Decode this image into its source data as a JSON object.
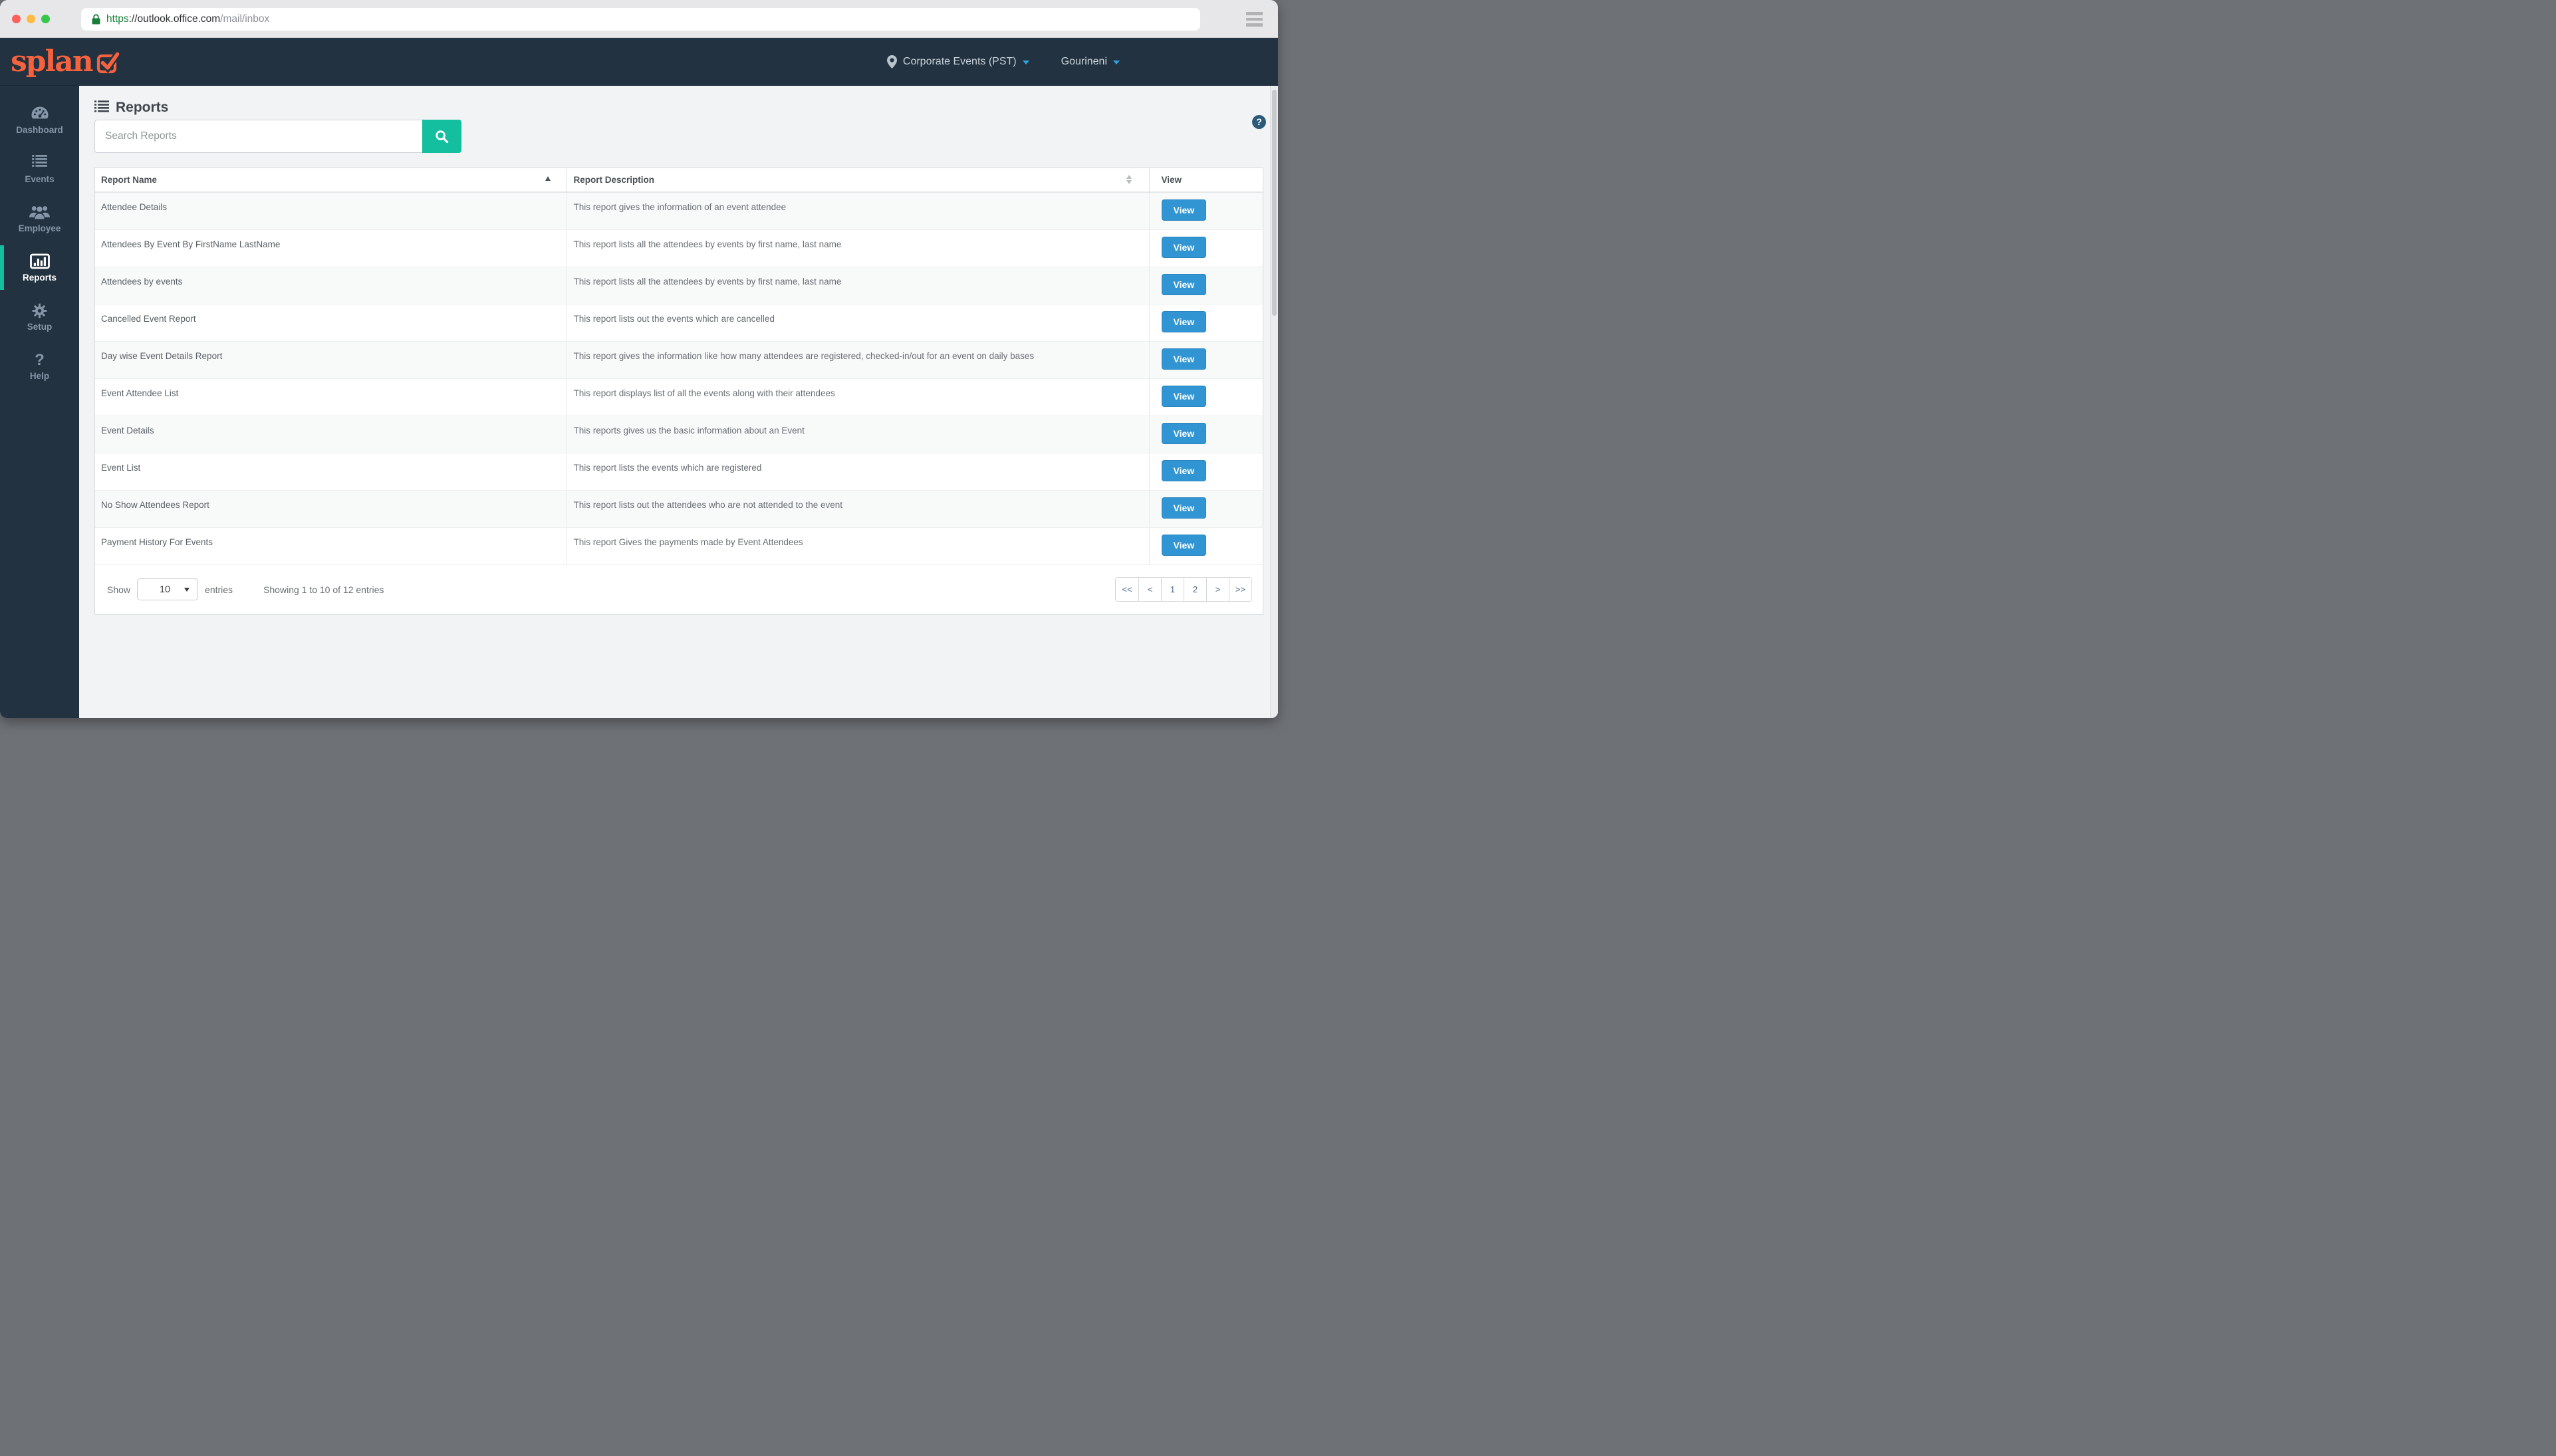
{
  "browser": {
    "url": {
      "scheme": "https",
      "host": "://outlook.office.com",
      "path": "/mail/inbox"
    }
  },
  "header": {
    "logo_text": "splan",
    "location_label": "Corporate Events (PST)",
    "user_label": "Gourineni"
  },
  "sidebar": {
    "items": [
      {
        "label": "Dashboard",
        "icon": "dashboard-gauge-icon",
        "active": false
      },
      {
        "label": "Events",
        "icon": "events-list-icon",
        "active": false
      },
      {
        "label": "Employee",
        "icon": "employee-group-icon",
        "active": false
      },
      {
        "label": "Reports",
        "icon": "reports-chart-icon",
        "active": true
      },
      {
        "label": "Setup",
        "icon": "setup-gear-icon",
        "active": false
      },
      {
        "label": "Help",
        "icon": "help-question-icon",
        "active": false
      }
    ]
  },
  "page": {
    "title": "Reports",
    "search_placeholder": "Search Reports"
  },
  "table": {
    "columns": [
      {
        "label": "Report Name",
        "sort": "asc"
      },
      {
        "label": "Report Description",
        "sort": "both"
      },
      {
        "label": "View",
        "sort": "none"
      }
    ],
    "action_label": "View",
    "rows": [
      {
        "name": "Attendee Details",
        "description": "This report gives the information of an event attendee"
      },
      {
        "name": "Attendees By Event By FirstName LastName",
        "description": "This report lists all the attendees by events by first name, last name"
      },
      {
        "name": "Attendees by events",
        "description": "This report lists all the attendees by events by first name, last name"
      },
      {
        "name": "Cancelled Event Report",
        "description": "This report lists out the events which are cancelled"
      },
      {
        "name": "Day wise Event Details Report",
        "description": "This report gives the information like how many attendees are registered, checked-in/out for an event on daily bases"
      },
      {
        "name": "Event Attendee List",
        "description": "This report displays list of all the events along with their attendees"
      },
      {
        "name": "Event Details",
        "description": "This reports gives us the basic information about an Event"
      },
      {
        "name": "Event List",
        "description": "This report lists the events which are registered"
      },
      {
        "name": "No Show Attendees Report",
        "description": "This report lists out the attendees who are not attended to the event"
      },
      {
        "name": "Payment History For Events",
        "description": "This report Gives the payments made by Event Attendees"
      }
    ]
  },
  "footer": {
    "show_label": "Show",
    "page_size": "10",
    "entries_label": "entries",
    "summary": "Showing 1 to 10 of 12 entries",
    "pagination": [
      "<<",
      "<",
      "1",
      "2",
      ">",
      ">>"
    ]
  },
  "colors": {
    "accent_teal": "#13BF9E",
    "brand_orange": "#F7623E",
    "button_blue": "#3095D2",
    "header_bg": "#233240",
    "link_blue_caret": "#2FA3DE",
    "traffic_red": "#FB605C",
    "traffic_yellow": "#FDBC40",
    "traffic_green": "#34C748",
    "url_green": "#188038"
  }
}
